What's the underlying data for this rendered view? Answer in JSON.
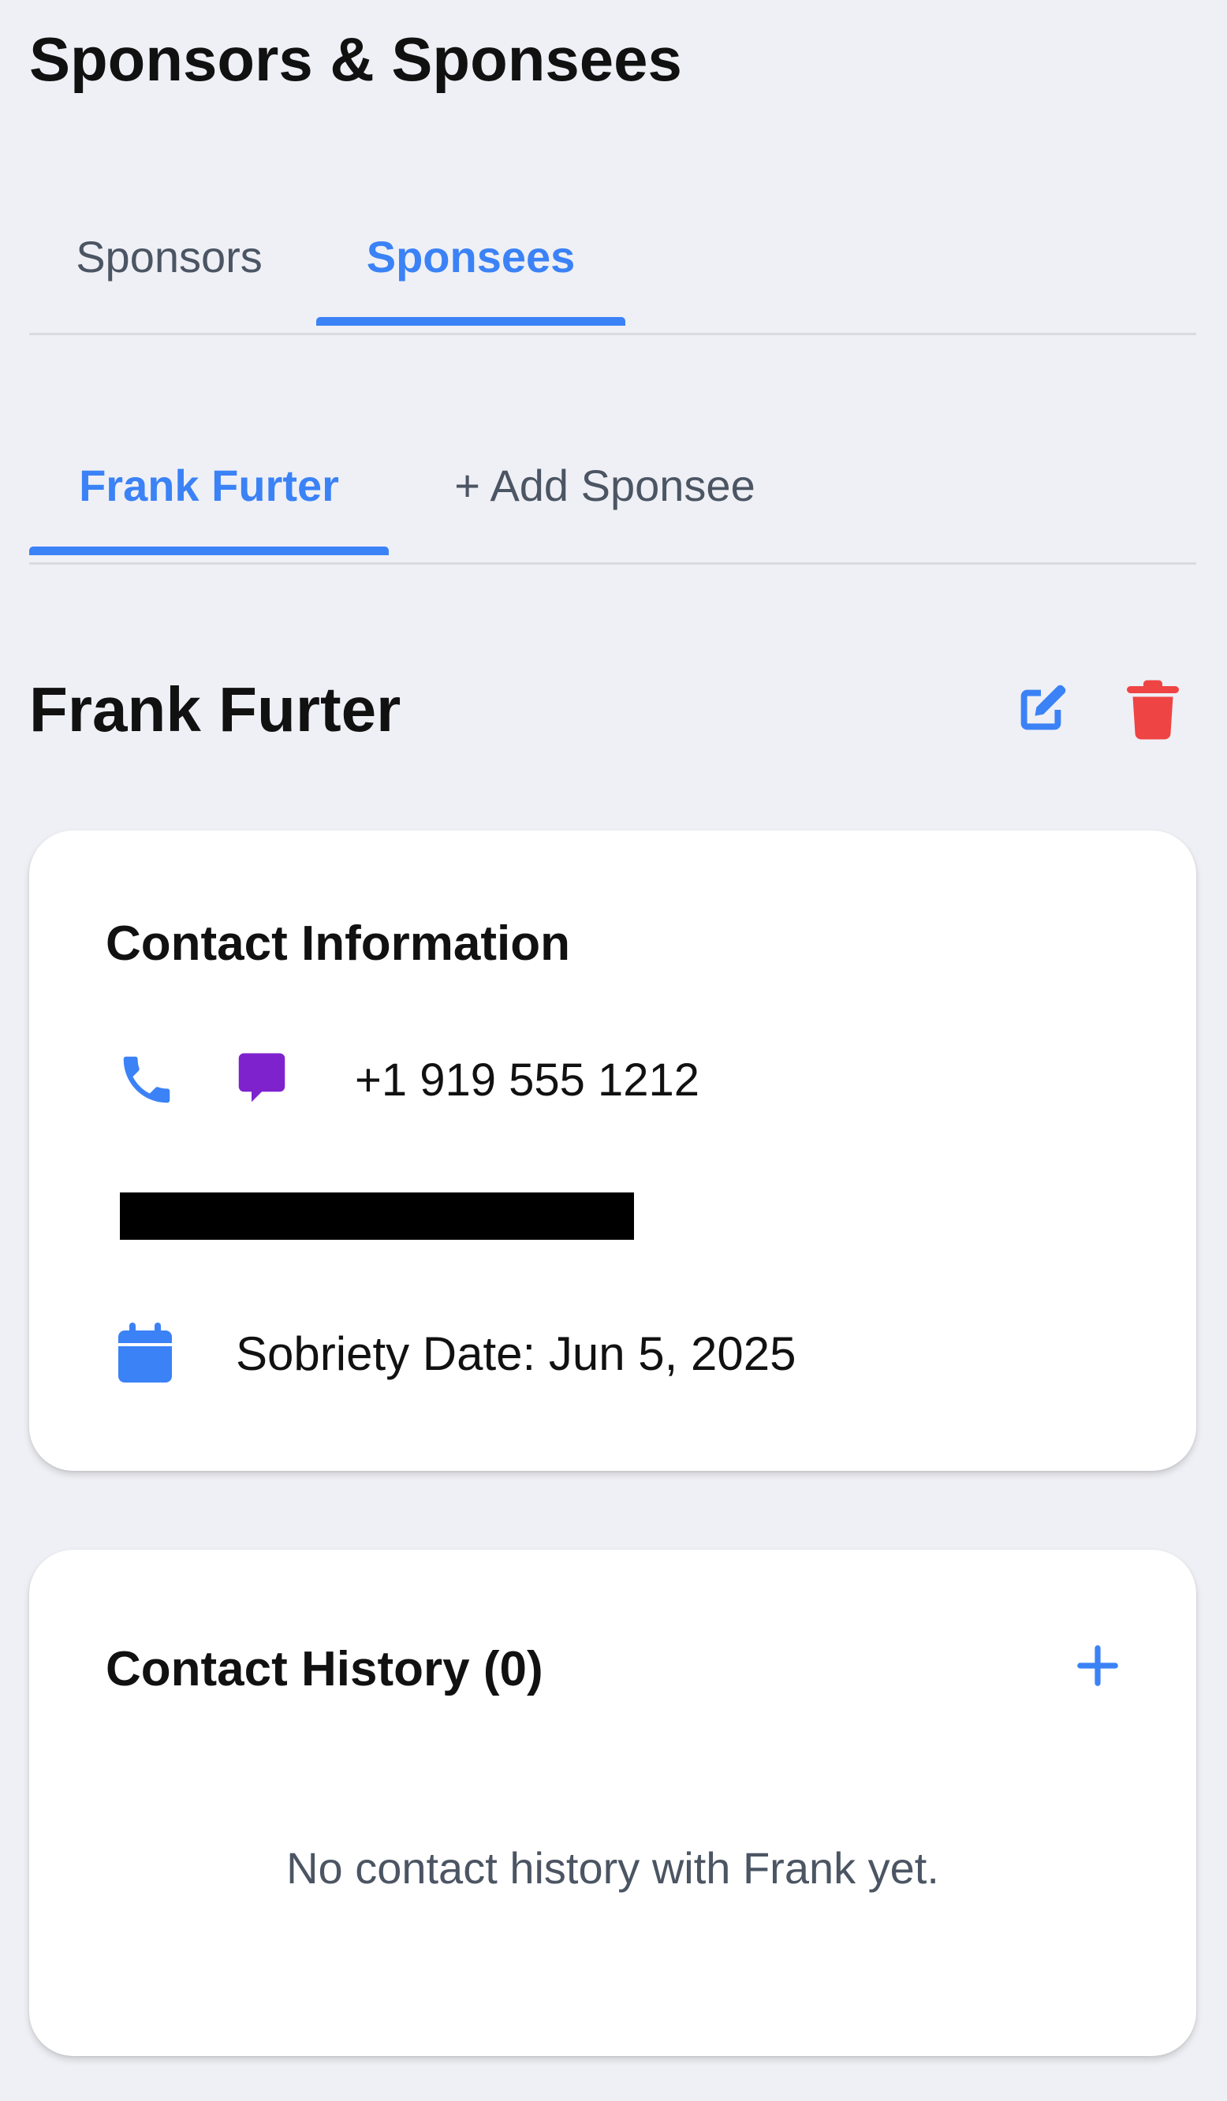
{
  "page": {
    "title": "Sponsors & Sponsees"
  },
  "primary_tabs": [
    {
      "label": "Sponsors",
      "active": false
    },
    {
      "label": "Sponsees",
      "active": true
    }
  ],
  "secondary_tabs": [
    {
      "label": "Frank Furter",
      "active": true
    },
    {
      "label": "+ Add Sponsee",
      "active": false
    }
  ],
  "person": {
    "name": "Frank Furter",
    "edit_icon": "edit-icon",
    "delete_icon": "trash-icon"
  },
  "contact_card": {
    "title": "Contact Information",
    "phone_icon": "phone-icon",
    "message_icon": "message-icon",
    "phone": "+1 919 555 1212",
    "calendar_icon": "calendar-icon",
    "sobriety_date": "Sobriety Date: Jun 5, 2025"
  },
  "history_card": {
    "title": "Contact History (0)",
    "add_icon": "plus-icon",
    "empty_message": "No contact history with Frank yet."
  },
  "colors": {
    "background": "#eff0f5",
    "accent": "#3b82f6",
    "danger": "#ef4444",
    "message": "#7e22ce",
    "muted_text": "#4b5563"
  }
}
